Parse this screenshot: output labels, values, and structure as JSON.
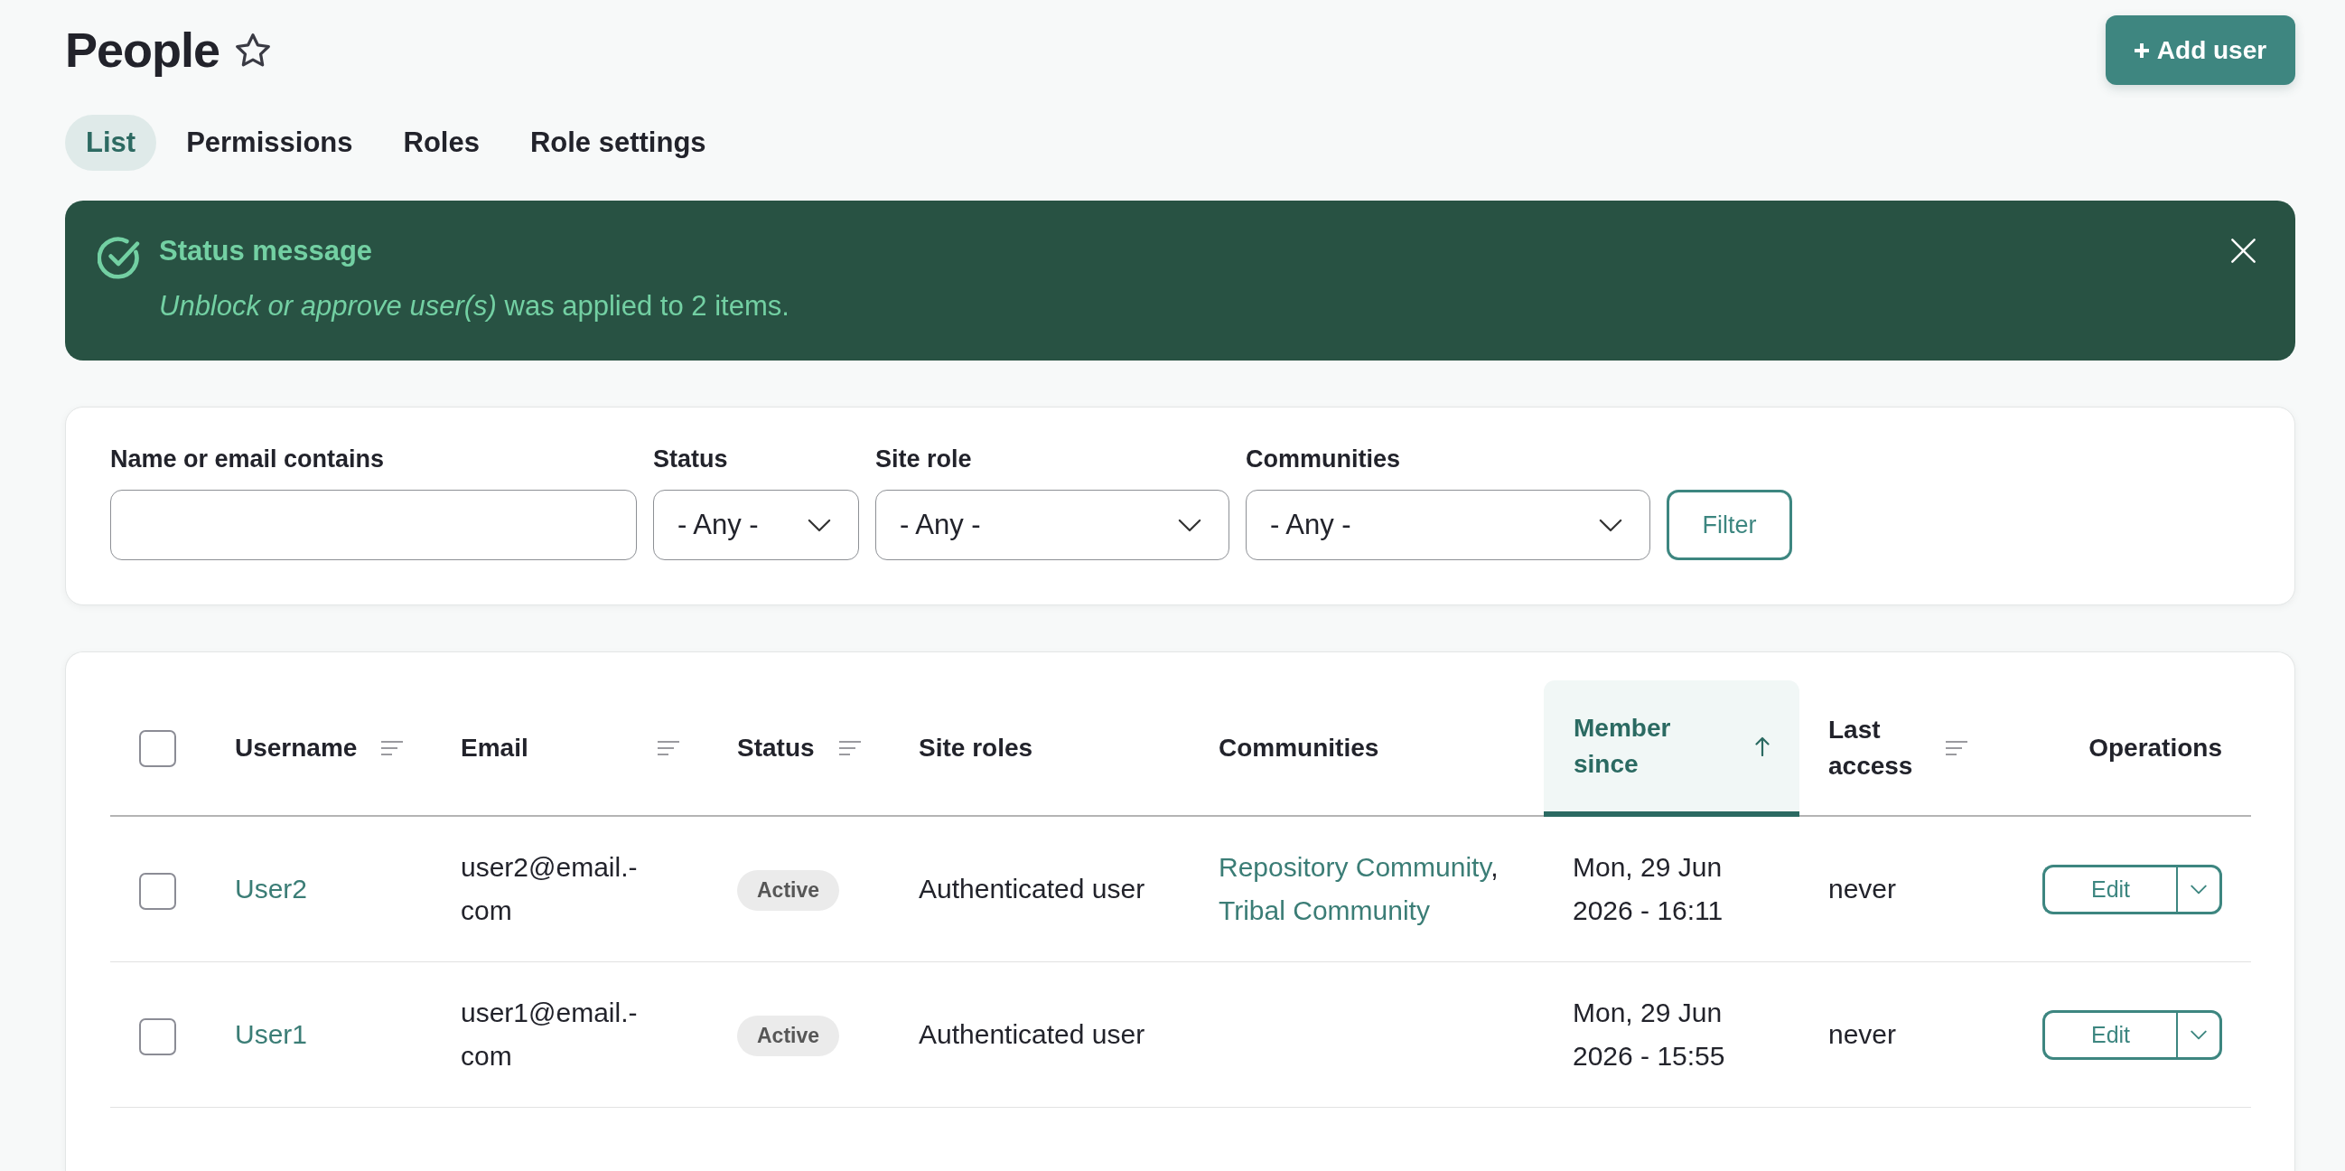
{
  "page": {
    "title": "People",
    "action_button": "Add user"
  },
  "tabs": [
    {
      "label": "List",
      "selected": true
    },
    {
      "label": "Permissions",
      "selected": false
    },
    {
      "label": "Roles",
      "selected": false
    },
    {
      "label": "Role settings",
      "selected": false
    }
  ],
  "status_message": {
    "title": "Status message",
    "text": "*Unblock or approve user(s)* was applied to 2 items."
  },
  "filters": {
    "fields": [
      {
        "kind": "text",
        "label": "Name or email contains"
      },
      {
        "kind": "select",
        "label": "Status",
        "value": "- Any -"
      },
      {
        "kind": "select",
        "label": "Site role",
        "value": "- Any -"
      },
      {
        "kind": "select",
        "label": "Communities",
        "value": "- Any -"
      }
    ],
    "button": "Filter"
  },
  "table": {
    "select_all": {
      "checked": false
    },
    "columns": [
      {
        "label": "Username",
        "sortable": true,
        "sorted": false
      },
      {
        "label": "Email",
        "sortable": true,
        "sorted": false
      },
      {
        "label": "Status",
        "sortable": true,
        "sorted": false
      },
      {
        "label": "Site roles",
        "sortable": false
      },
      {
        "label": "Communities",
        "sortable": false
      },
      {
        "label": "Member since",
        "sortable": true,
        "sorted": true
      },
      {
        "label": "Last access",
        "sortable": true,
        "sorted": false
      },
      {
        "label": "Operations",
        "sortable": false
      }
    ],
    "rows": [
      {
        "checked": false,
        "username": "User2",
        "email": "user2@email.-com",
        "status": "Active",
        "site_roles": "Authenticated user",
        "communities": [
          {
            "name": "Repository Community",
            "suffix": ","
          },
          {
            "name": "Tribal Community"
          }
        ],
        "member_since": "Mon, 29 Jun 2026 - 16:11",
        "last_access": "never",
        "operation": "Edit"
      },
      {
        "checked": false,
        "username": "User1",
        "email": "user1@email.-com",
        "status": "Active",
        "site_roles": "Authenticated user",
        "member_since": "Mon, 29 Jun 2026 - 15:55",
        "last_access": "never",
        "operation": "Edit"
      }
    ]
  }
}
